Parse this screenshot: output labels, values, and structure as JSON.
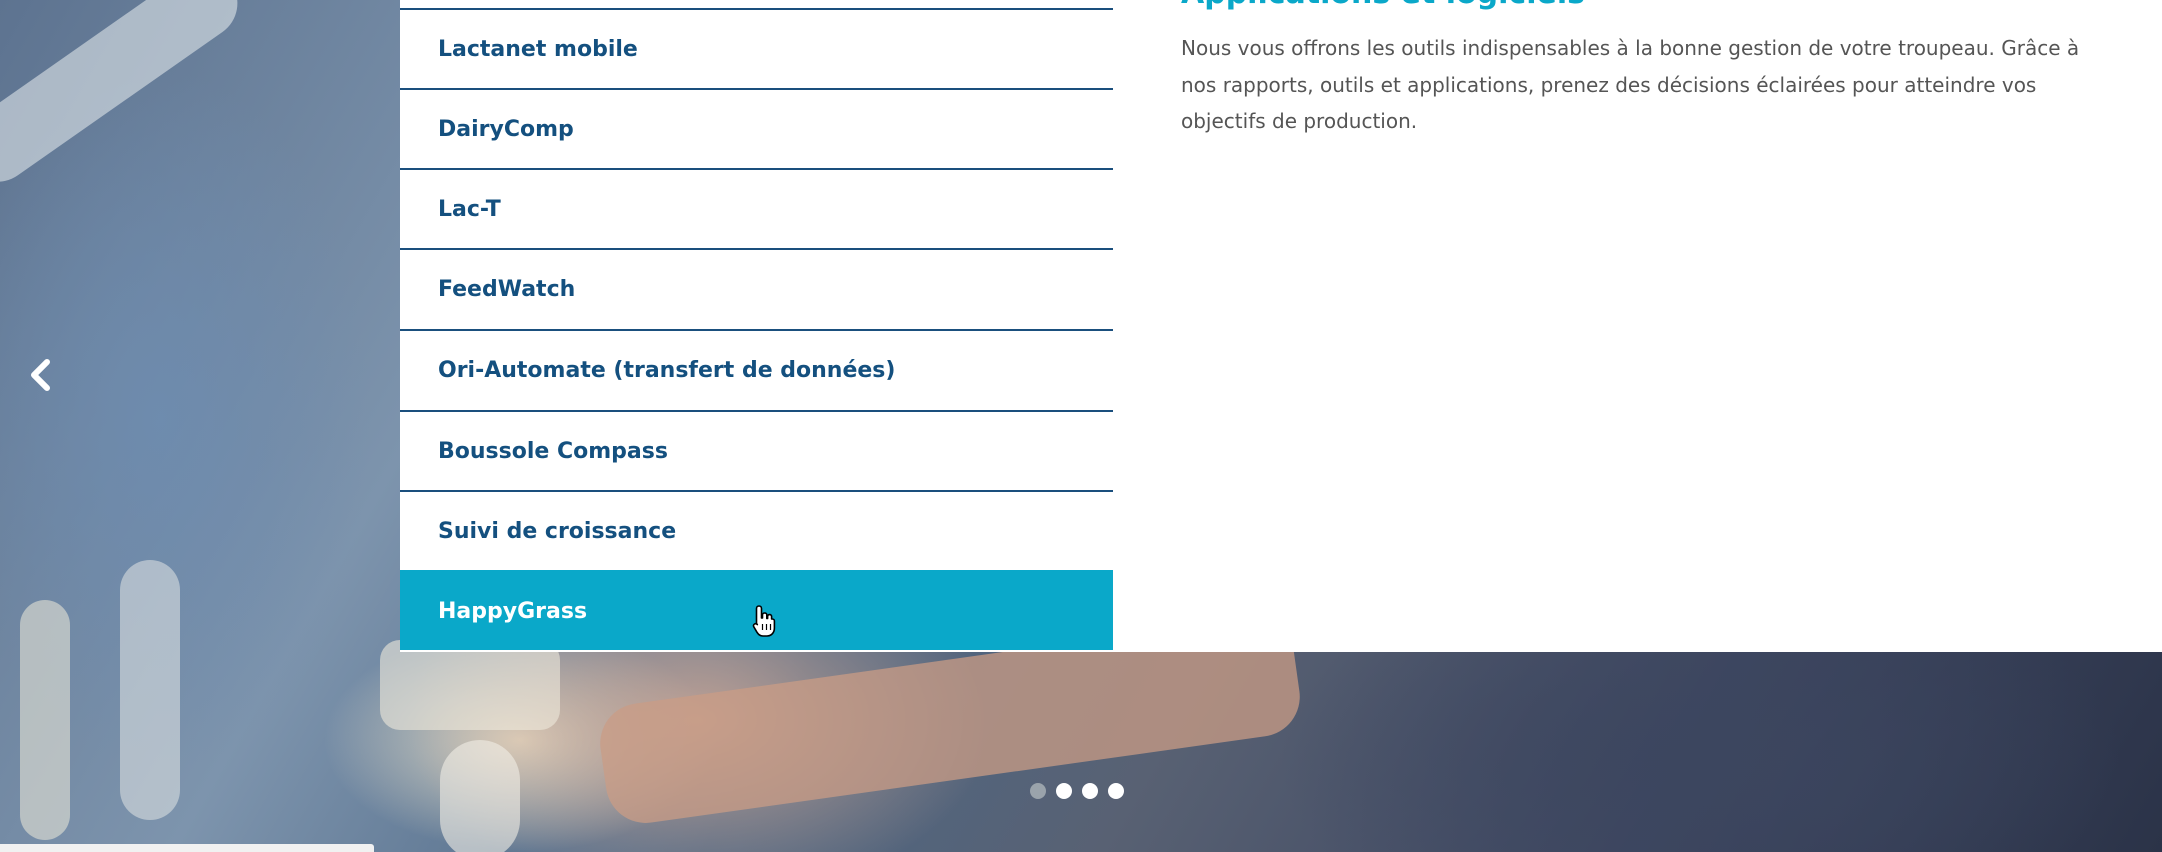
{
  "menu": {
    "items": [
      {
        "label": "Lactanet mobile"
      },
      {
        "label": "DairyComp"
      },
      {
        "label": "Lac-T"
      },
      {
        "label": "FeedWatch"
      },
      {
        "label": "Ori-Automate (transfert de données)"
      },
      {
        "label": "Boussole Compass"
      },
      {
        "label": "Suivi de croissance"
      },
      {
        "label": "HappyGrass"
      }
    ],
    "active_index": 7,
    "colors": {
      "text": "#14507f",
      "border": "#1a4f7d",
      "active_bg": "#0aa8c9",
      "active_text": "#ffffff"
    }
  },
  "content": {
    "title": "Applications et logiciels",
    "description": "Nous vous offrons les outils indispensables à la bonne gestion de votre troupeau. Grâce à nos rapports, outils et applications, prenez des décisions éclairées pour atteindre vos objectifs de production.",
    "title_color": "#0aa8c9"
  },
  "carousel": {
    "prev_icon": "chevron-left-icon",
    "dots": [
      {
        "active": true
      },
      {
        "active": false
      },
      {
        "active": false
      },
      {
        "active": false
      }
    ]
  },
  "pointer": {
    "icon": "hand-pointer-icon"
  }
}
